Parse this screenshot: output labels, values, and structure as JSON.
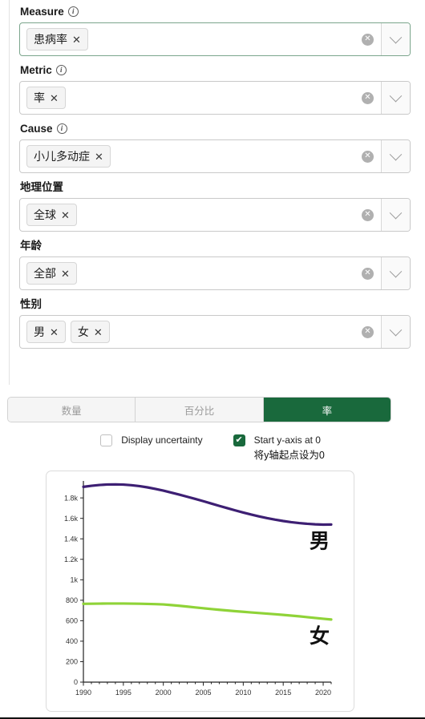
{
  "filters": [
    {
      "label": "Measure",
      "has_info": true,
      "focused": true,
      "chips": [
        "患病率"
      ],
      "clear_icon": "clear-circle-icon",
      "caret_icon": "chevron-down-icon"
    },
    {
      "label": "Metric",
      "has_info": true,
      "focused": false,
      "chips": [
        "率"
      ],
      "clear_icon": "clear-circle-icon",
      "caret_icon": "chevron-down-icon"
    },
    {
      "label": "Cause",
      "has_info": true,
      "focused": false,
      "chips": [
        "小儿多动症"
      ],
      "clear_icon": "clear-circle-icon",
      "caret_icon": "chevron-down-icon"
    },
    {
      "label": "地理位置",
      "has_info": false,
      "focused": false,
      "chips": [
        "全球"
      ],
      "clear_icon": "clear-circle-icon",
      "caret_icon": "chevron-down-icon"
    },
    {
      "label": "年龄",
      "has_info": false,
      "focused": false,
      "chips": [
        "全部"
      ],
      "clear_icon": "clear-circle-icon",
      "caret_icon": "chevron-down-icon"
    },
    {
      "label": "性别",
      "has_info": false,
      "focused": false,
      "chips": [
        "男",
        "女"
      ],
      "clear_icon": "clear-circle-icon",
      "caret_icon": "chevron-down-icon"
    }
  ],
  "tabs": [
    {
      "label": "数量",
      "active": false
    },
    {
      "label": "百分比",
      "active": false
    },
    {
      "label": "率",
      "active": true
    }
  ],
  "options": {
    "uncertainty": {
      "label": "Display uncertainty",
      "checked": false
    },
    "yaxis_zero": {
      "label": "Start y-axis at 0",
      "sublabel": "将y轴起点设为0",
      "checked": true,
      "check_glyph": "✔"
    }
  },
  "colors": {
    "accent_green": "#19693c",
    "male_line": "#3d1f73",
    "female_line": "#8fd338",
    "chip_bg": "#f4f4f4",
    "border": "#c9c9c9"
  },
  "chart_data": {
    "type": "line",
    "title": "",
    "xlabel": "",
    "ylabel": "",
    "xlim": [
      1990,
      2021
    ],
    "ylim": [
      0,
      1950
    ],
    "grid": false,
    "legend": "inline-right",
    "xticks": [
      1990,
      1995,
      2000,
      2005,
      2010,
      2015,
      2020
    ],
    "yticks": [
      0,
      200,
      400,
      600,
      800,
      1000,
      1200,
      1400,
      1600,
      1800
    ],
    "ytick_labels": [
      "0",
      "200",
      "400",
      "600",
      "800",
      "1k",
      "1.2k",
      "1.4k",
      "1.6k",
      "1.8k"
    ],
    "x": [
      1990,
      1991,
      1992,
      1993,
      1994,
      1995,
      1996,
      1997,
      1998,
      1999,
      2000,
      2001,
      2002,
      2003,
      2004,
      2005,
      2006,
      2007,
      2008,
      2009,
      2010,
      2011,
      2012,
      2013,
      2014,
      2015,
      2016,
      2017,
      2018,
      2019,
      2020,
      2021
    ],
    "series": [
      {
        "name": "男",
        "color": "#3d1f73",
        "values": [
          1908,
          1918,
          1926,
          1931,
          1932,
          1930,
          1924,
          1915,
          1903,
          1888,
          1871,
          1852,
          1832,
          1811,
          1790,
          1768,
          1745,
          1722,
          1700,
          1678,
          1657,
          1637,
          1619,
          1602,
          1587,
          1574,
          1563,
          1554,
          1547,
          1542,
          1539,
          1540
        ]
      },
      {
        "name": "女",
        "color": "#8fd338",
        "values": [
          765,
          766,
          767,
          768,
          768,
          768,
          767,
          766,
          764,
          762,
          759,
          753,
          746,
          738,
          730,
          722,
          714,
          707,
          700,
          693,
          687,
          681,
          675,
          669,
          663,
          657,
          650,
          643,
          635,
          627,
          619,
          612
        ]
      }
    ]
  }
}
